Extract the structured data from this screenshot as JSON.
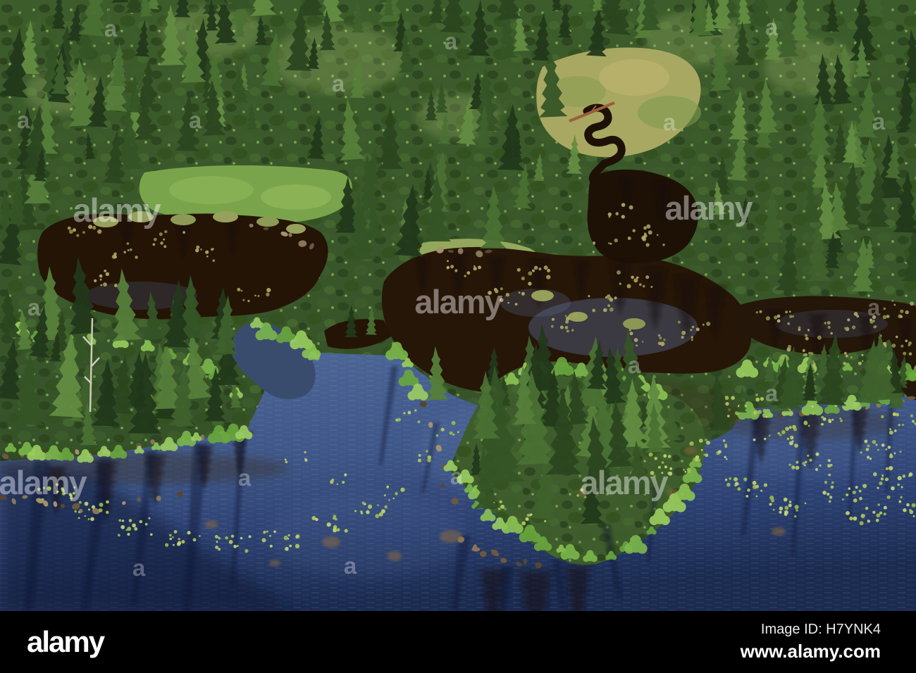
{
  "meta": {
    "description": "Aerial view of a boreal spruce forest wetland: dark tannin ponds and a blue lake with small tree-covered islands, rocky shorelines, grassy clearings and floating water-lily pads"
  },
  "watermark": {
    "logo_text": "alamy",
    "tile_letter": "a"
  },
  "footer": {
    "logo_text": "alamy",
    "image_id_text": "Image ID: H7YNK4",
    "website_text": "www.alamy.com"
  },
  "colors": {
    "bar-bg": "#000000",
    "bar-text": "#ffffff",
    "watermark": "#ffffff",
    "forest-green": "#3b5829",
    "sunlit-green": "#86bd4f",
    "meadow-tan": "#a8a862",
    "pond-brown": "#241405",
    "lake-blue": "#3f5788",
    "lake-deep": "#16254a",
    "lilypad-green": "#b6cc5f",
    "rock-tan": "#8a7558"
  }
}
